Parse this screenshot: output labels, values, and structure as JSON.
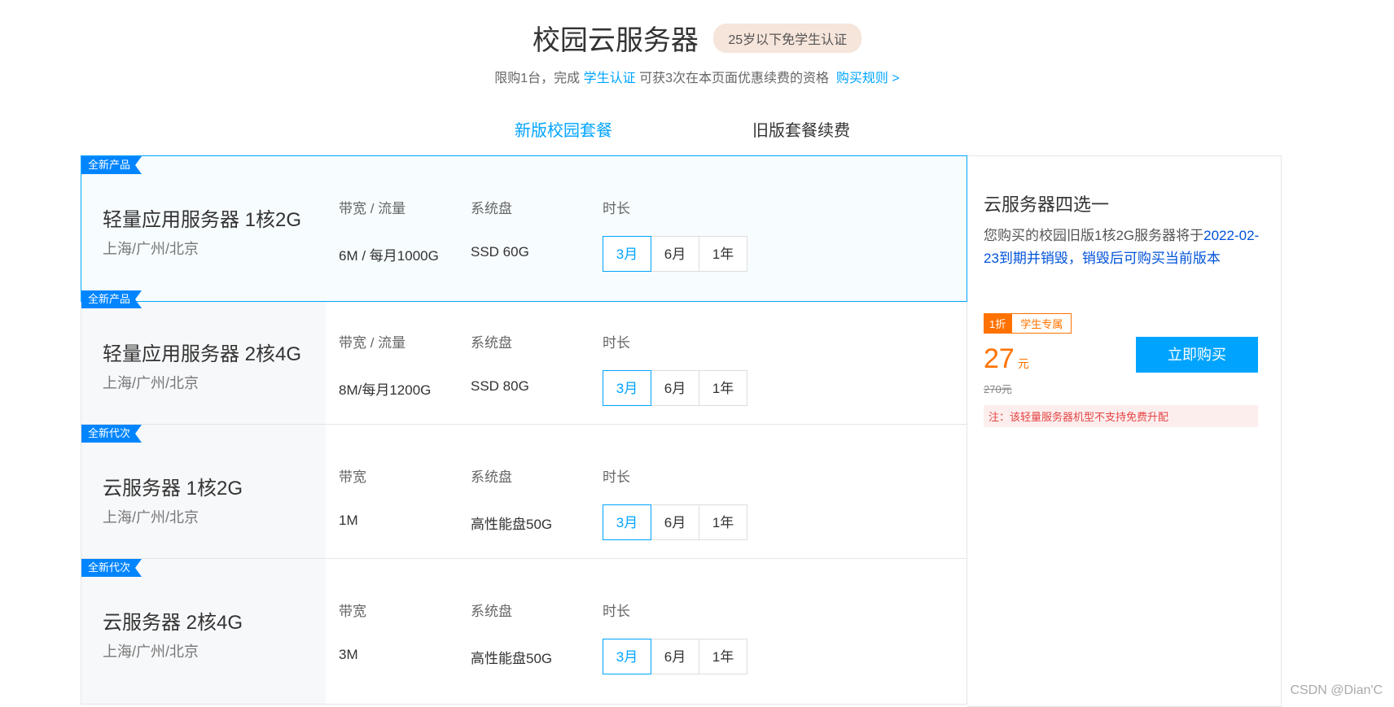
{
  "header": {
    "title": "校园云服务器",
    "badge": "25岁以下免学生认证",
    "subtitle_pre": "限购1台，完成",
    "subtitle_link1": "学生认证",
    "subtitle_mid": "可获3次在本页面优惠续费的资格",
    "subtitle_link2": "购买规则 >"
  },
  "tabs": [
    {
      "label": "新版校园套餐",
      "active": true
    },
    {
      "label": "旧版套餐续费",
      "active": false
    }
  ],
  "plans": [
    {
      "ribbon": "全新产品",
      "name": "轻量应用服务器 1核2G",
      "region": "上海/广州/北京",
      "bw_label": "带宽 / 流量",
      "bw_value": "6M / 每月1000G",
      "disk_label": "系统盘",
      "disk_value": "SSD 60G",
      "dur_label": "时长",
      "durations": [
        "3月",
        "6月",
        "1年"
      ],
      "selected_duration": "3月"
    },
    {
      "ribbon": "全新产品",
      "name": "轻量应用服务器 2核4G",
      "region": "上海/广州/北京",
      "bw_label": "带宽 / 流量",
      "bw_value": "8M/每月1200G",
      "disk_label": "系统盘",
      "disk_value": "SSD 80G",
      "dur_label": "时长",
      "durations": [
        "3月",
        "6月",
        "1年"
      ],
      "selected_duration": "3月"
    },
    {
      "ribbon": "全新代次",
      "name": "云服务器 1核2G",
      "region": "上海/广州/北京",
      "bw_label": "带宽",
      "bw_value": "1M",
      "disk_label": "系统盘",
      "disk_value": "高性能盘50G",
      "dur_label": "时长",
      "durations": [
        "3月",
        "6月",
        "1年"
      ],
      "selected_duration": "3月"
    },
    {
      "ribbon": "全新代次",
      "name": "云服务器 2核4G",
      "region": "上海/广州/北京",
      "bw_label": "带宽",
      "bw_value": "3M",
      "disk_label": "系统盘",
      "disk_value": "高性能盘50G",
      "dur_label": "时长",
      "durations": [
        "3月",
        "6月",
        "1年"
      ],
      "selected_duration": "3月"
    }
  ],
  "side": {
    "title": "云服务器四选一",
    "desc_pre": "您购买的校园旧版1核2G服务器将于",
    "desc_hl": "2022-02-23到期并销毁，销毁后可购买当前版本",
    "tag_discount": "1折",
    "tag_student": "学生专属",
    "price": "27",
    "price_unit": "元",
    "old_price": "270元",
    "buy_label": "立即购买",
    "note": "注：该轻量服务器机型不支持免费升配"
  },
  "watermark": "CSDN @Dian'C",
  "colors": {
    "accent": "#00a4ff",
    "orange": "#ff7200",
    "ribbon": "#0085ff"
  }
}
